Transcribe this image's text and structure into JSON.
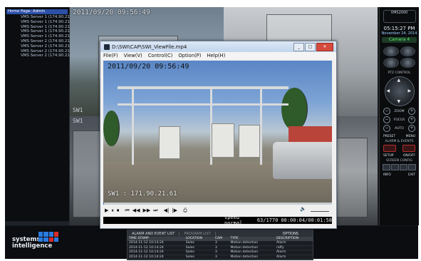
{
  "tree": {
    "root": "Home Page: Admin",
    "items": [
      "VMS Server 1 (174.90.21.",
      "VMS Server 1 (174.90.21.",
      "VMS Server 1 (174.90.21.",
      "VMS Server 1 (174.90.21.",
      "VMS Server 1 (174.90.21.",
      "VMS Server 2 (174.90.21.",
      "VMS Server 2 (174.90.21.",
      "VMS Server 2 (174.90.21.",
      "VMS Server 2 (174.90.21."
    ]
  },
  "wall": {
    "tile1_timestamp": "2011/09/20  09:56:49",
    "tile1_cam": "SW1",
    "tile3_cam": "SW1"
  },
  "player": {
    "title": "D:\\SWI\\CAP\\SWI_ViewFile.mp4",
    "menu": [
      "File(F)",
      "View(V)",
      "Control(C)",
      "Option(P)",
      "Help(H)"
    ],
    "video_timestamp": "2011/09/20  09:56:49",
    "video_cam": "SW1 : 171.90.21.61",
    "controls": [
      "▶",
      "⏸",
      "⏹",
      "⏮",
      "◀◀",
      "▶▶",
      "⏭",
      "◀|",
      "|▶",
      "⎙"
    ],
    "volume_icon": "🔈",
    "progress": 0.004,
    "speed": "speed normal",
    "frames": "63/1770",
    "time": "00:00:04/00:01:58"
  },
  "right_panel": {
    "logo": "VMS2000",
    "clock": "05:15:27 PM",
    "date": "November 24, 2014",
    "camera": "Camera 4",
    "ptz_caption": "PTZ CONTROL",
    "zoom_label": "ZOOM",
    "focus_label": "FOCUS",
    "iris_label": "IRIS",
    "auto_label": "AUTO",
    "preset": "PRESET",
    "menu": "MENU",
    "alarm_caption": "ALARM & EVENTS",
    "setup": "SETUP",
    "on_off": "ON/OFF",
    "screen_caption": "SCREEN CONFIG",
    "info": "INFO",
    "exit": "EXIT"
  },
  "brand": {
    "line1": "systems",
    "line2": "intelligence"
  },
  "alarm": {
    "tab1": "ALARM AND EVENT LIST",
    "tab2": "PROGRAM LIST",
    "options": "OPTIONS",
    "headers": [
      "TIME STAMP",
      "LOCATION",
      "CAM",
      "TYPE",
      "DESCRIPTION"
    ],
    "rows": [
      [
        "2014-11-12 10:14:24",
        "Sales",
        "3",
        "Motion detection",
        "Alarm"
      ],
      [
        "2014-11-12 10:14:24",
        "Sales",
        "3",
        "Motion detection",
        "raffy"
      ],
      [
        "2014-11-12 10:14:24",
        "Sales",
        "3",
        "Motion detection",
        "Alarm"
      ],
      [
        "2014-11-12 10:14:24",
        "Sales",
        "3",
        "Motion detection",
        "Alarm"
      ]
    ]
  }
}
